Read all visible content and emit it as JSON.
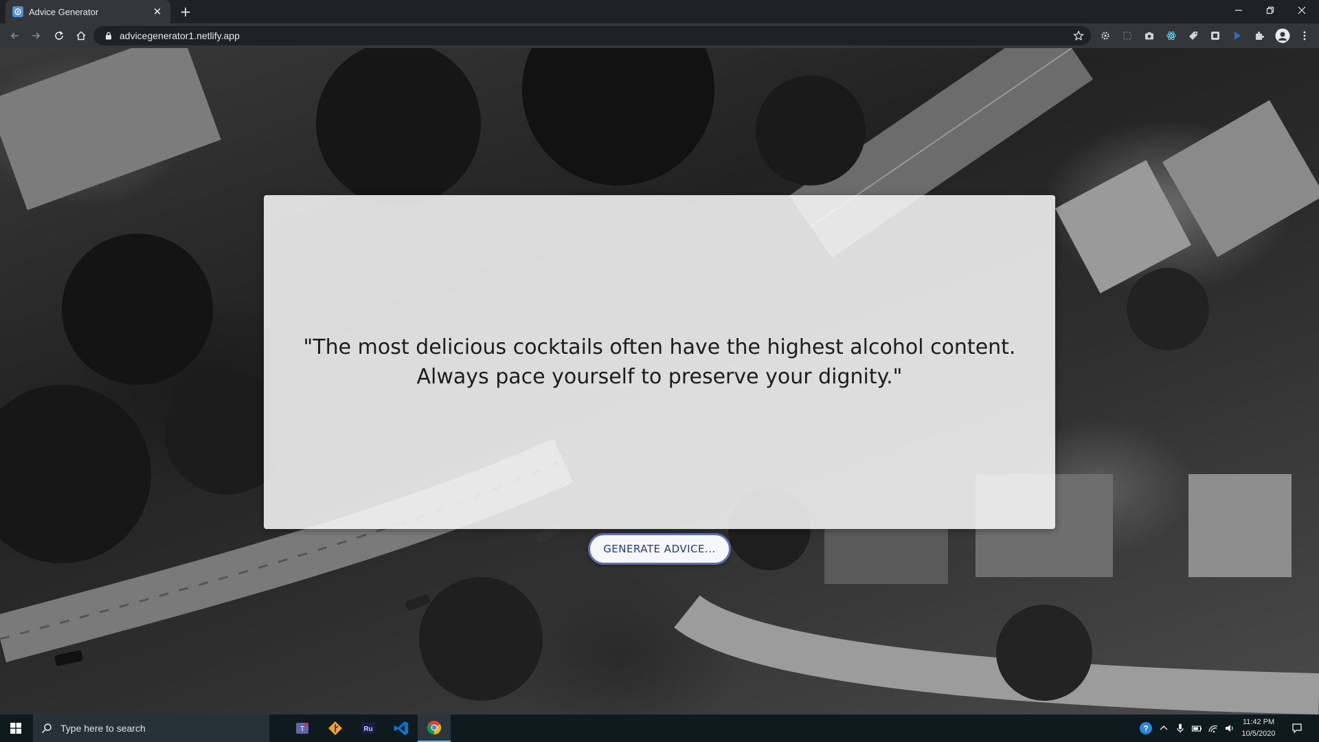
{
  "browser": {
    "tab_title": "Advice Generator",
    "url": "advicegenerator1.netlify.app"
  },
  "page": {
    "advice_text": "\"The most delicious cocktails often have the highest alcohol content. Always pace yourself to preserve your dignity.\"",
    "button_label": "GENERATE ADVICE..."
  },
  "taskbar": {
    "search_placeholder": "Type here to search",
    "apps": [
      "teams",
      "git",
      "ru",
      "vscode",
      "chrome"
    ],
    "time": "11:42 PM",
    "date": "10/5/2020"
  },
  "colors": {
    "button_border": "#5a6fb0",
    "button_text": "#1c3a8a",
    "taskbar": "#0f1a1f",
    "chrome_dark": "#202124"
  }
}
